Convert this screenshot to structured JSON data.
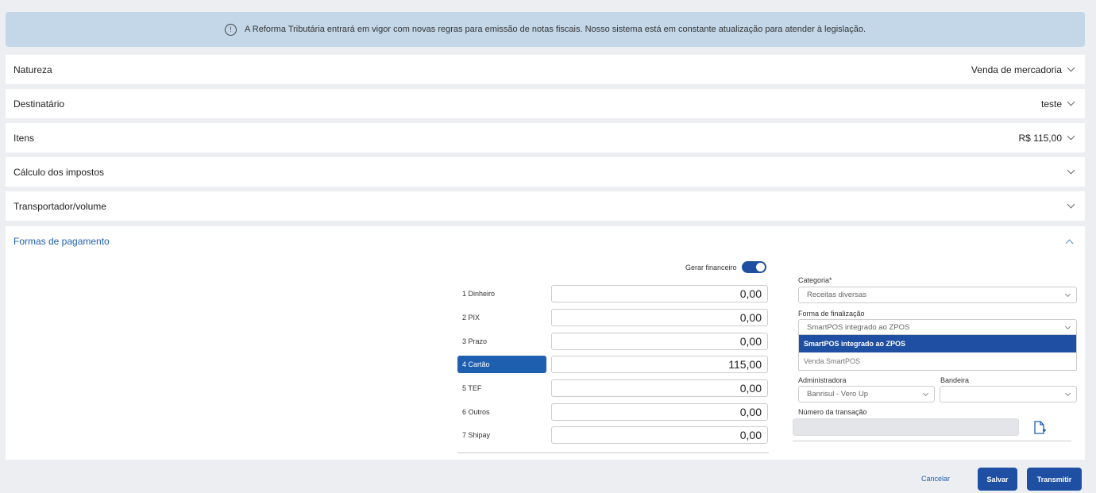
{
  "banner": {
    "text": "A Reforma Tributária entrará em vigor com novas regras para emissão de notas fiscais. Nosso sistema está em constante atualização para atender à legislação.",
    "icon": "info-circle-icon"
  },
  "sections": [
    {
      "title": "Natureza",
      "value": "Venda de mercadoria"
    },
    {
      "title": "Destinatário",
      "value": "teste"
    },
    {
      "title": "Itens",
      "value": "R$ 115,00"
    },
    {
      "title": "Cálculo dos impostos",
      "value": ""
    },
    {
      "title": "Transportador/volume",
      "value": ""
    }
  ],
  "payment": {
    "title": "Formas de pagamento",
    "toggle_label": "Gerar financeiro",
    "toggle_on": true,
    "methods": [
      {
        "label": "1 Dinheiro",
        "value": "0,00"
      },
      {
        "label": "2 PIX",
        "value": "0,00"
      },
      {
        "label": "3 Prazo",
        "value": "0,00"
      },
      {
        "label": "4 Cartão",
        "value": "115,00",
        "active": true
      },
      {
        "label": "5 TEF",
        "value": "0,00"
      },
      {
        "label": "6 Outros",
        "value": "0,00"
      },
      {
        "label": "7 Shipay",
        "value": "0,00"
      }
    ],
    "categoria_label": "Categoria*",
    "categoria_value": "Receitas diversas",
    "finalizacao_label": "Forma de finalização",
    "finalizacao_value": "SmartPOS integrado ao ZPOS",
    "finalizacao_options": [
      "SmartPOS integrado ao ZPOS",
      "Venda SmartPOS"
    ],
    "administradora_label": "Administradora",
    "administradora_value": "Banrisul - Vero Up",
    "bandeira_label": "Bandeira",
    "bandeira_value": "",
    "transacao_label": "Número da transação",
    "transacao_value": ""
  },
  "footer": {
    "cancel": "Cancelar",
    "save": "Salvar",
    "transmit": "Transmitir"
  },
  "colors": {
    "primary": "#1f4fa3",
    "banner_bg": "#c3d7e8",
    "link": "#1f5fb0"
  }
}
